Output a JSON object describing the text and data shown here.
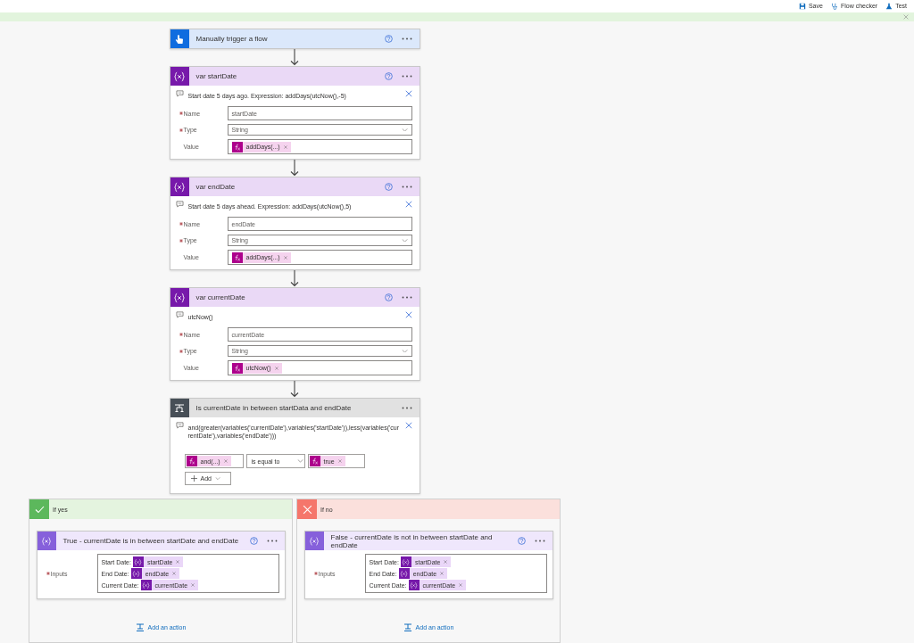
{
  "toolbar": {
    "buttons": [
      {
        "kind": "save",
        "label": "Save"
      },
      {
        "kind": "checker",
        "label": "Flow checker"
      },
      {
        "kind": "test",
        "label": "Test"
      }
    ]
  },
  "steps": [
    {
      "kind": "trigger",
      "title": "Manually trigger a flow"
    },
    {
      "kind": "variable",
      "title": "var startDate",
      "comment": "Start date 5 days ago. Expression: addDays(utcNow(),-5)",
      "fields": [
        {
          "label": "Name",
          "required": true,
          "kind": "text",
          "value": "startDate"
        },
        {
          "label": "Type",
          "required": true,
          "kind": "select",
          "value": "String"
        },
        {
          "label": "Value",
          "required": false,
          "kind": "token",
          "value": "addDays(...)"
        }
      ]
    },
    {
      "kind": "variable",
      "title": "var endDate",
      "comment": "Start date 5 days ahead. Expression: addDays(utcNow(),5)",
      "fields": [
        {
          "label": "Name",
          "required": true,
          "kind": "text",
          "value": "endDate"
        },
        {
          "label": "Type",
          "required": true,
          "kind": "select",
          "value": "String"
        },
        {
          "label": "Value",
          "required": false,
          "kind": "token",
          "value": "addDays(...)"
        }
      ]
    },
    {
      "kind": "variable",
      "title": "var currentDate",
      "comment": "utcNow()",
      "fields": [
        {
          "label": "Name",
          "required": true,
          "kind": "text",
          "value": "currentDate"
        },
        {
          "label": "Type",
          "required": true,
          "kind": "select",
          "value": "String"
        },
        {
          "label": "Value",
          "required": false,
          "kind": "token",
          "value": "utcNow()"
        }
      ]
    },
    {
      "kind": "condition",
      "title": "Is currentDate in between startData and endDate",
      "comment": "and(greater(variables('currentDate'),variables('startDate')),less(variables('currentDate'),variables('endDate')))",
      "left": "and(...)",
      "operator": "is equal to",
      "right": "true",
      "add": "Add"
    }
  ],
  "branches": [
    {
      "kind": "yes",
      "title": "If yes",
      "action": {
        "title": "True - currentDate is in between startDate and endDate",
        "inputs_label": "Inputs",
        "lines": [
          {
            "label": "Start Date:",
            "token": "startDate"
          },
          {
            "label": "End Date:",
            "token": "endDate"
          },
          {
            "label": "Current Date:",
            "token": "currentDate"
          }
        ]
      },
      "add_action": "Add an action"
    },
    {
      "kind": "no",
      "title": "If no",
      "action": {
        "title": "False - currentDate is not in between startDate and endDate",
        "inputs_label": "Inputs",
        "lines": [
          {
            "label": "Start Date:",
            "token": "startDate"
          },
          {
            "label": "End Date:",
            "token": "endDate"
          },
          {
            "label": "Current Date:",
            "token": "currentDate"
          }
        ]
      },
      "add_action": "Add an action"
    }
  ]
}
